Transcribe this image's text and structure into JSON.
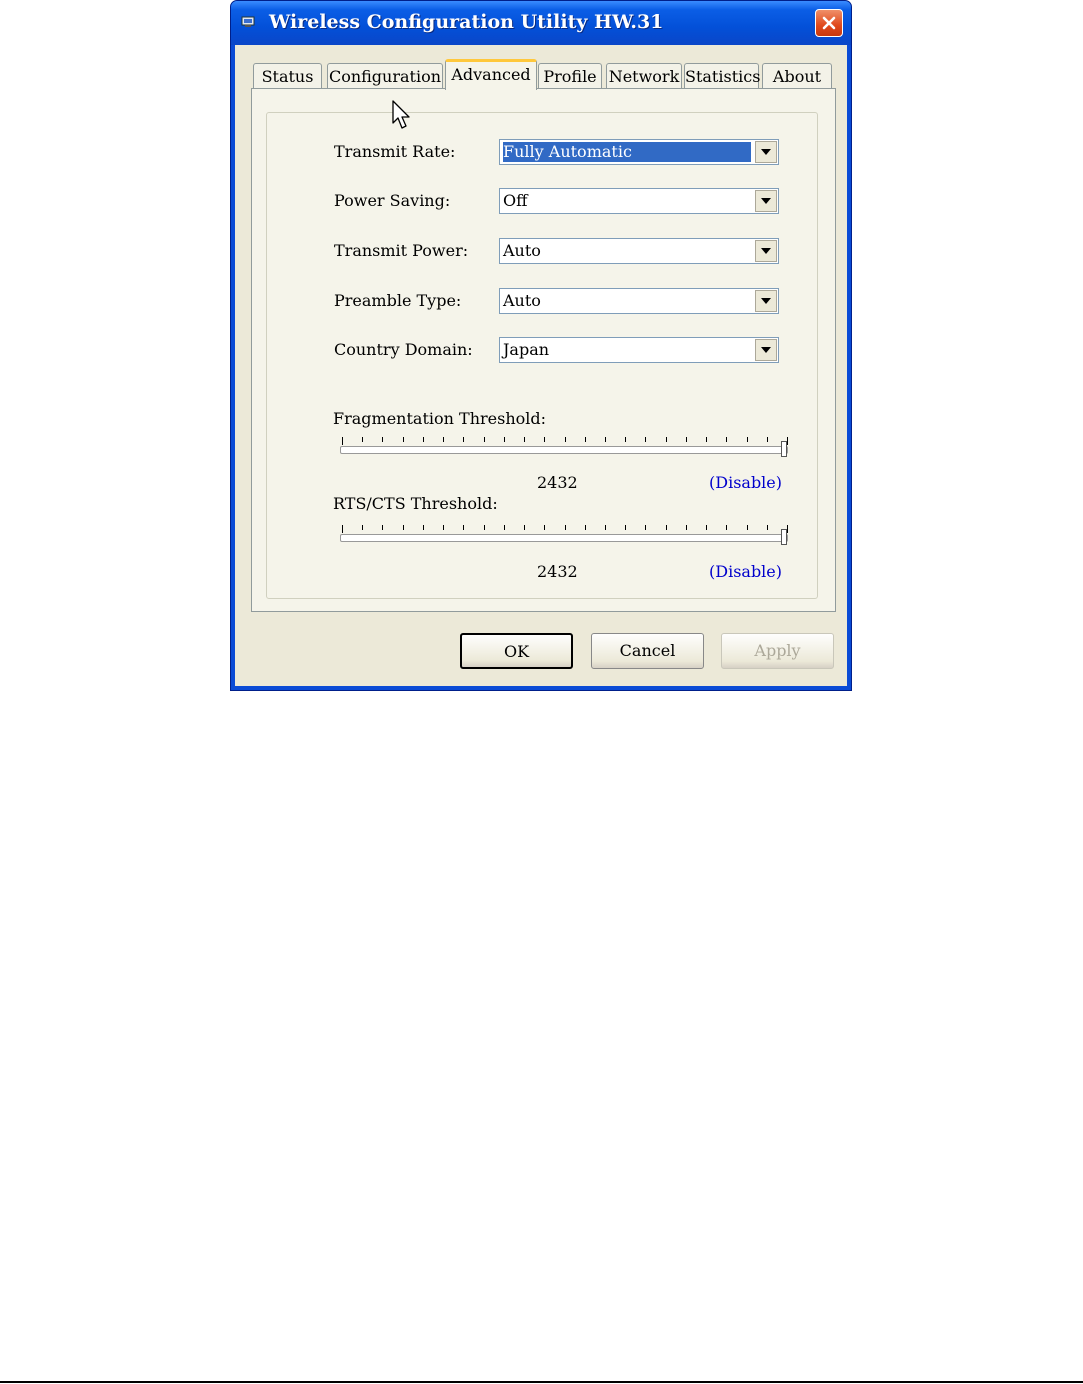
{
  "window": {
    "title": "Wireless Configuration Utility HW.31"
  },
  "tabs": [
    {
      "label": "Status",
      "active": false
    },
    {
      "label": "Configuration",
      "active": false
    },
    {
      "label": "Advanced",
      "active": true
    },
    {
      "label": "Profile",
      "active": false
    },
    {
      "label": "Network",
      "active": false
    },
    {
      "label": "Statistics",
      "active": false
    },
    {
      "label": "About",
      "active": false
    }
  ],
  "advanced": {
    "transmit_rate": {
      "label": "Transmit Rate:",
      "value": "Fully Automatic"
    },
    "power_saving": {
      "label": "Power Saving:",
      "value": "Off"
    },
    "transmit_power": {
      "label": "Transmit Power:",
      "value": "Auto"
    },
    "preamble_type": {
      "label": "Preamble Type:",
      "value": "Auto"
    },
    "country_domain": {
      "label": "Country Domain:",
      "value": "Japan"
    },
    "fragmentation": {
      "label": "Fragmentation Threshold:",
      "value": "2432",
      "status": "(Disable)",
      "slider_fraction": 1.0
    },
    "rts_cts": {
      "label": "RTS/CTS Threshold:",
      "value": "2432",
      "status": "(Disable)",
      "slider_fraction": 1.0
    }
  },
  "buttons": {
    "ok": "OK",
    "cancel": "Cancel",
    "apply": "Apply"
  },
  "colors": {
    "titlebar": "#0350d8",
    "dialog_face": "#ece9d8",
    "selection": "#316ac5",
    "link_blue": "#0000cc",
    "close_button": "#e0491c"
  },
  "icons": [
    "network-adapter-icon",
    "close-icon",
    "dropdown-arrow-icon",
    "mouse-cursor-icon"
  ]
}
